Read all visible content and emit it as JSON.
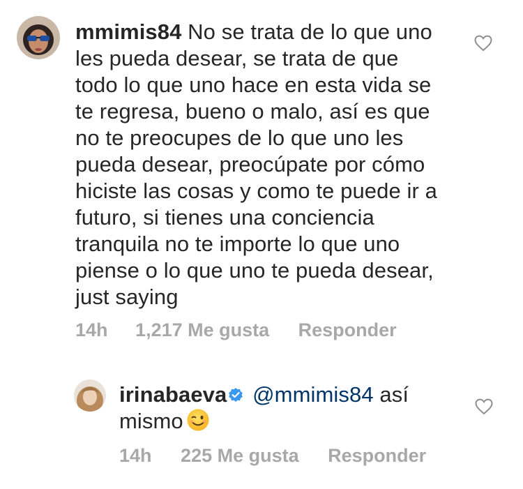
{
  "comments": [
    {
      "username": "mmimis84",
      "text": "No se trata de lo que uno les pueda desear, se trata de que todo lo que uno hace en esta vida se te regresa, bueno o malo, así es que no te preocupes de lo que uno les pueda desear, preocúpate por cómo hiciste las cosas y como te puede ir a futuro, si tienes una conciencia tranquila no te importe lo que uno piense o lo que uno te pueda desear, just saying",
      "time": "14h",
      "likes": "1,217 Me gusta",
      "reply_label": "Responder"
    },
    {
      "username": "irinabaeva",
      "verified": true,
      "mention": "@mmimis84",
      "text": "así mismo",
      "emoji": "winking-face",
      "time": "14h",
      "likes": "225 Me gusta",
      "reply_label": "Responder"
    }
  ],
  "colors": {
    "text": "#262626",
    "meta": "#a8a8a8",
    "mention": "#003569",
    "verified": "#3897f0"
  }
}
